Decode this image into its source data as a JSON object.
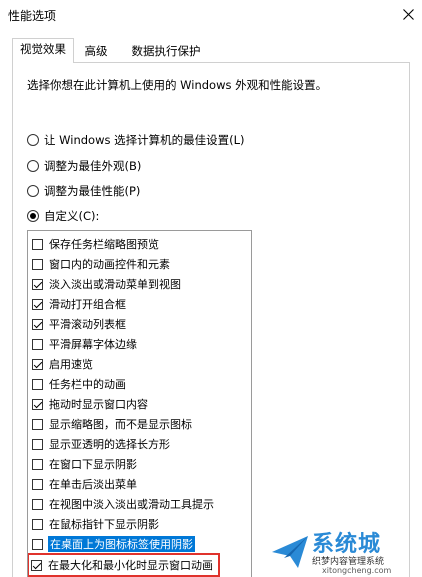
{
  "window": {
    "title": "性能选项"
  },
  "tabs": [
    {
      "label": "视觉效果",
      "active": true
    },
    {
      "label": "高级",
      "active": false
    },
    {
      "label": "数据执行保护",
      "active": false
    }
  ],
  "description": "选择你想在此计算机上使用的 Windows 外观和性能设置。",
  "radios": [
    {
      "label": "让 Windows 选择计算机的最佳设置(L)",
      "selected": false
    },
    {
      "label": "调整为最佳外观(B)",
      "selected": false
    },
    {
      "label": "调整为最佳性能(P)",
      "selected": false
    },
    {
      "label": "自定义(C):",
      "selected": true
    }
  ],
  "effects": [
    {
      "label": "保存任务栏缩略图预览",
      "checked": false
    },
    {
      "label": "窗口内的动画控件和元素",
      "checked": false
    },
    {
      "label": "淡入淡出或滑动菜单到视图",
      "checked": true
    },
    {
      "label": "滑动打开组合框",
      "checked": true
    },
    {
      "label": "平滑滚动列表框",
      "checked": true
    },
    {
      "label": "平滑屏幕字体边缘",
      "checked": false
    },
    {
      "label": "启用速览",
      "checked": true
    },
    {
      "label": "任务栏中的动画",
      "checked": false
    },
    {
      "label": "拖动时显示窗口内容",
      "checked": true
    },
    {
      "label": "显示缩略图，而不是显示图标",
      "checked": false
    },
    {
      "label": "显示亚透明的选择长方形",
      "checked": false
    },
    {
      "label": "在窗口下显示阴影",
      "checked": false
    },
    {
      "label": "在单击后淡出菜单",
      "checked": false
    },
    {
      "label": "在视图中淡入淡出或滑动工具提示",
      "checked": false
    },
    {
      "label": "在鼠标指针下显示阴影",
      "checked": false
    },
    {
      "label": "在桌面上为图标标签使用阴影",
      "checked": false,
      "selected": true
    },
    {
      "label": "在最大化和最小化时显示窗口动画",
      "checked": true,
      "highlighted": true
    }
  ],
  "watermark": {
    "name": "系统城",
    "subtitle": "织梦内容管理系统",
    "url": "xitongcheng.com",
    "color": "#2a8ad6"
  }
}
